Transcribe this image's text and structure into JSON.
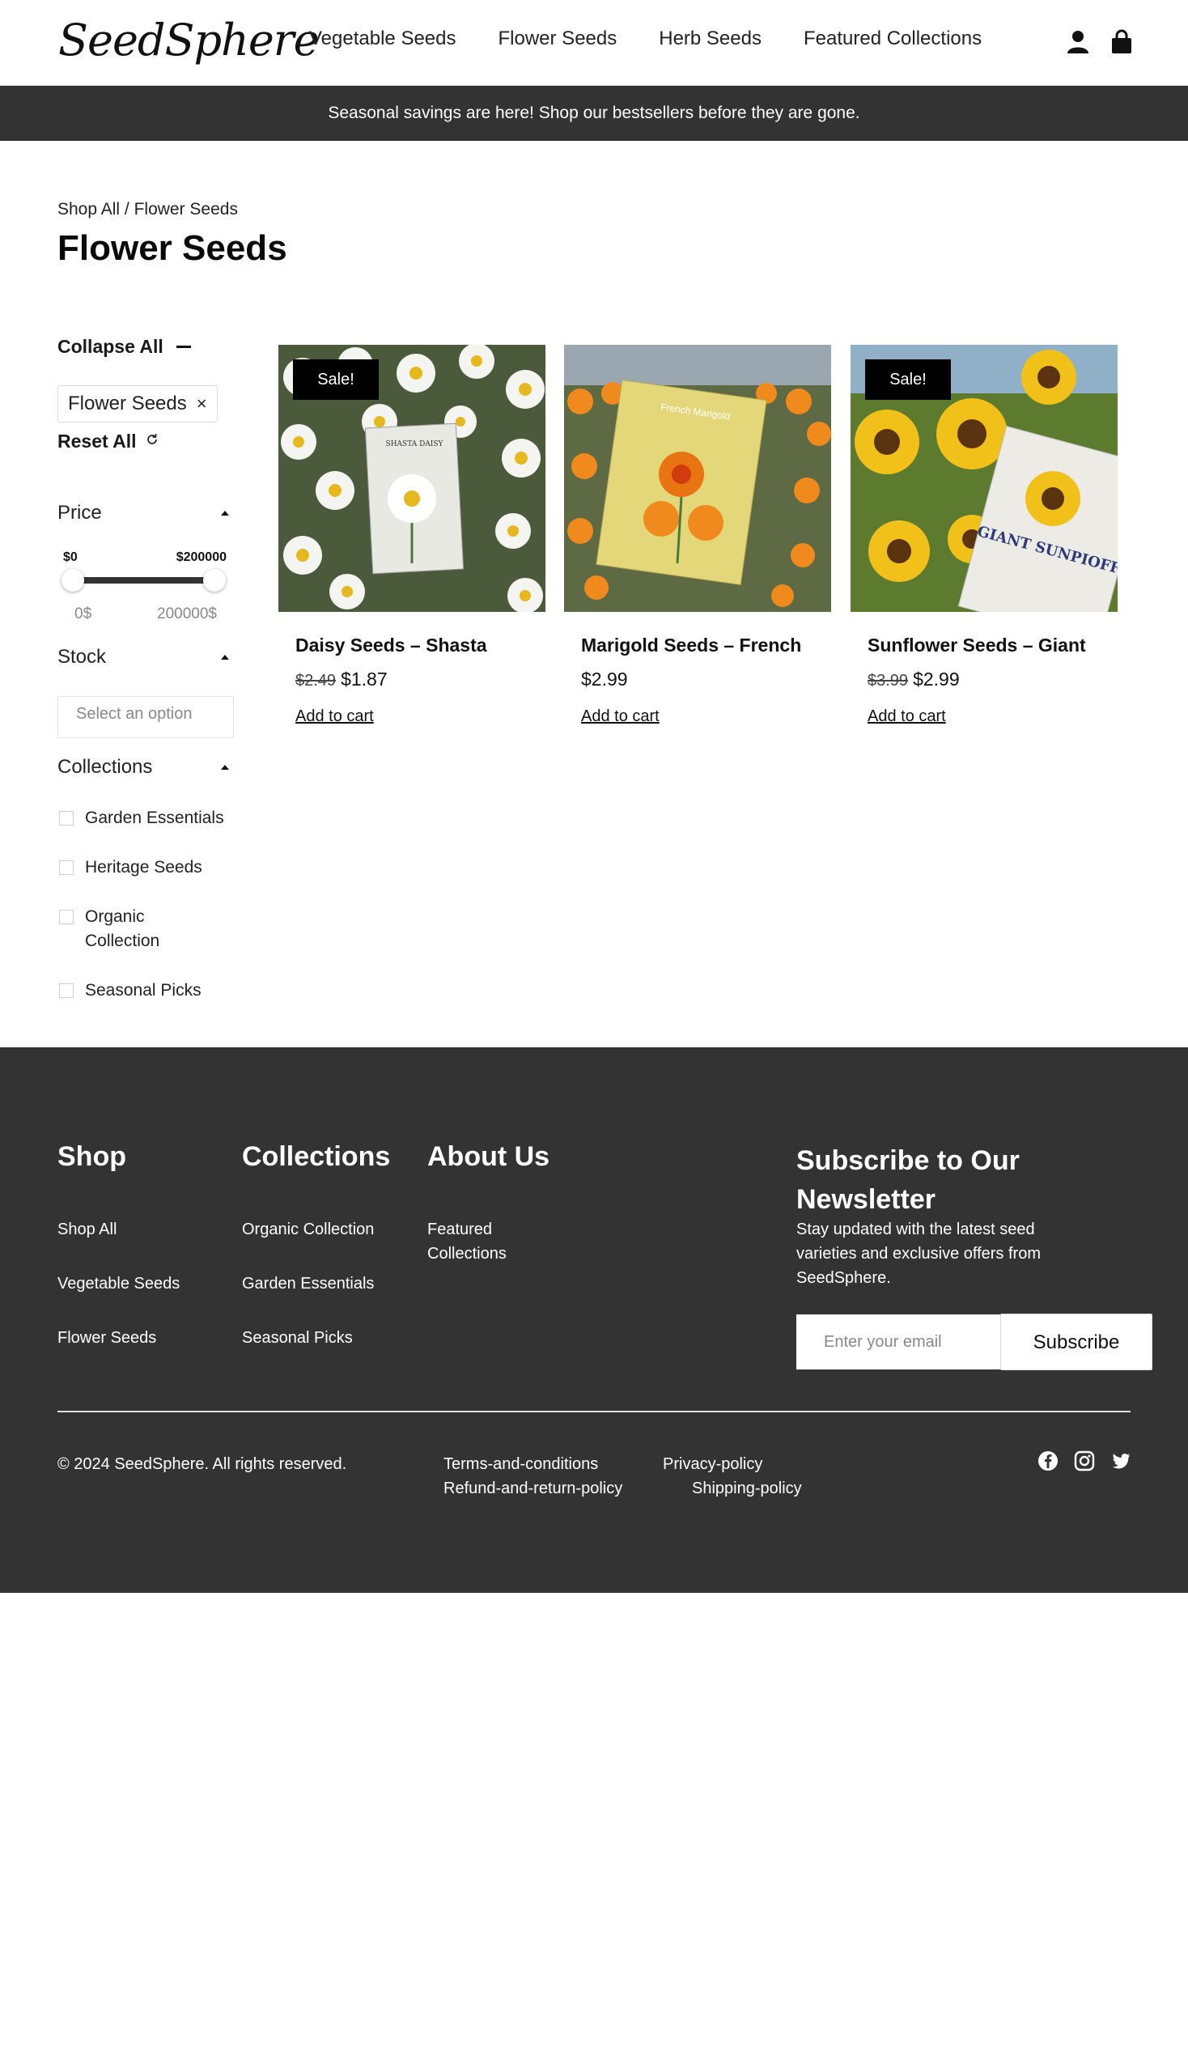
{
  "header": {
    "logo": "SeedSphere",
    "nav": [
      "Vegetable Seeds",
      "Flower Seeds",
      "Herb Seeds",
      "Featured Collections"
    ],
    "icons": [
      "account-icon",
      "cart-bag-icon"
    ]
  },
  "announcement": "Seasonal savings are here! Shop our bestsellers before they are gone.",
  "breadcrumb": {
    "root": "Shop All",
    "separator": " / ",
    "current": "Flower Seeds"
  },
  "page_title": "Flower Seeds",
  "sidebar": {
    "collapse_all": "Collapse All",
    "active_filter": "Flower Seeds",
    "remove_symbol": "×",
    "reset_all": "Reset All",
    "price": {
      "heading": "Price",
      "min_label": "$0",
      "max_label": "$200000",
      "min_value": "0$",
      "max_value": "200000$"
    },
    "stock": {
      "heading": "Stock",
      "placeholder": "Select an option"
    },
    "collections": {
      "heading": "Collections",
      "items": [
        "Garden Essentials",
        "Heritage Seeds",
        "Organic Collection",
        "Seasonal Picks"
      ]
    }
  },
  "products": [
    {
      "name": "Daisy Seeds – Shasta",
      "old_price": "$2.49",
      "price": "$1.87",
      "sale": "Sale!",
      "cta": "Add to cart",
      "packet": "SHASTA DAISY"
    },
    {
      "name": "Marigold Seeds – French",
      "old_price": "",
      "price": "$2.99",
      "sale": "",
      "cta": "Add to cart",
      "packet": "French Marigold"
    },
    {
      "name": "Sunflower Seeds – Giant",
      "old_price": "$3.99",
      "price": "$2.99",
      "sale": "Sale!",
      "cta": "Add to cart",
      "packet": "GIANT SUNPIOFF"
    }
  ],
  "footer": {
    "shop": {
      "heading": "Shop",
      "links": [
        "Shop All",
        "Vegetable Seeds",
        "Flower Seeds"
      ]
    },
    "collections": {
      "heading": "Collections",
      "links": [
        "Organic Collection",
        "Garden Essentials",
        "Seasonal Picks"
      ]
    },
    "about": {
      "heading": "About Us",
      "links": [
        "Featured Collections"
      ]
    },
    "newsletter": {
      "heading": "Subscribe to Our Newsletter",
      "text": "Stay updated with the latest seed varieties and exclusive offers from SeedSphere.",
      "placeholder": "Enter your email",
      "button": "Subscribe"
    },
    "copyright": "© 2024 SeedSphere. All rights reserved.",
    "legal": [
      "Terms-and-conditions",
      "Privacy-policy",
      "Refund-and-return-policy",
      "Shipping-policy"
    ],
    "social": [
      "facebook-icon",
      "instagram-icon",
      "twitter-icon"
    ]
  },
  "colors": {
    "dark": "#333333",
    "black": "#000000",
    "white": "#ffffff"
  }
}
